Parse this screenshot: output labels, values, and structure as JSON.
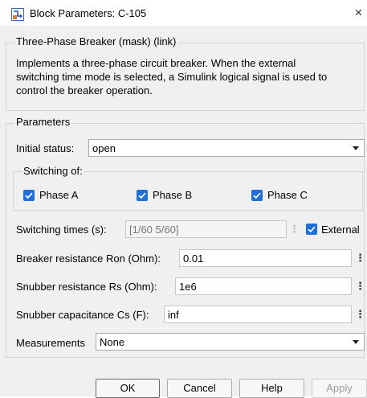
{
  "window": {
    "title": "Block Parameters: C-105",
    "close_symbol": "×"
  },
  "mask": {
    "heading": "Three-Phase Breaker (mask) (link)",
    "description_lines": [
      "Implements a three-phase circuit breaker. When the external",
      "switching time mode is selected, a Simulink logical signal is used to",
      "control the breaker operation."
    ]
  },
  "parameters": {
    "heading": "Parameters",
    "initial_status": {
      "label": "Initial status:",
      "value": "open"
    },
    "switching_of": {
      "heading": "Switching of:",
      "phases": [
        {
          "label": "Phase A",
          "checked": true
        },
        {
          "label": "Phase B",
          "checked": true
        },
        {
          "label": "Phase C",
          "checked": true
        }
      ]
    },
    "switching_times": {
      "label": "Switching times (s):",
      "value": "[1/60  5/60]",
      "disabled": true
    },
    "external": {
      "label": "External",
      "checked": true
    },
    "breaker_resistance": {
      "label": "Breaker resistance Ron (Ohm):",
      "value": "0.01"
    },
    "snubber_resistance": {
      "label": "Snubber resistance Rs (Ohm):",
      "value": "1e6"
    },
    "snubber_capacitance": {
      "label": "Snubber capacitance Cs (F):",
      "value": "inf"
    },
    "measurements": {
      "label": "Measurements",
      "value": "None"
    }
  },
  "buttons": {
    "ok": "OK",
    "cancel": "Cancel",
    "help": "Help",
    "apply": "Apply"
  },
  "icons": {
    "more_glyph": "⋮"
  },
  "colors": {
    "checkbox_accent": "#1e6fd9",
    "dialog_background": "#f0f0f0"
  }
}
